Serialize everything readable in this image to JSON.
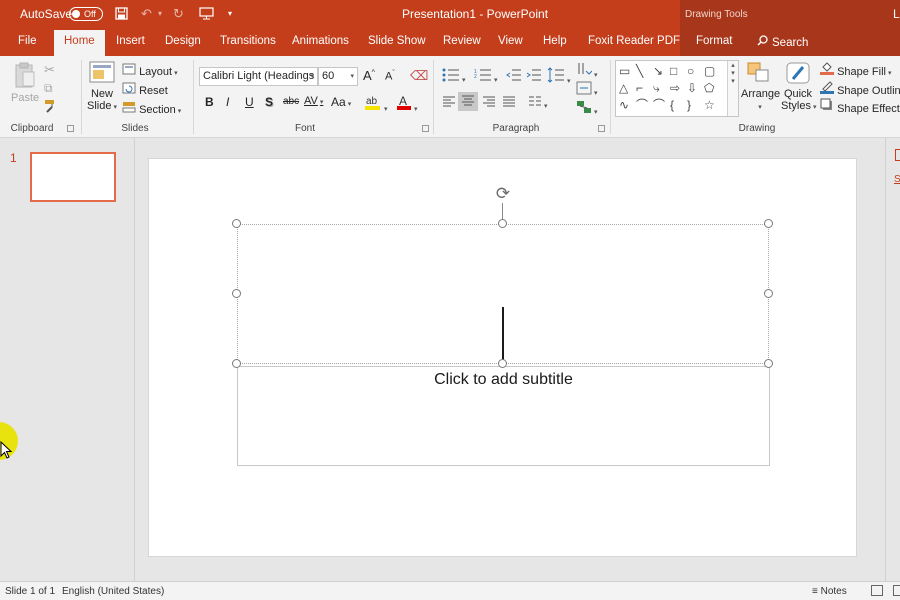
{
  "titlebar": {
    "autosave_label": "AutoSave",
    "autosave_state": "Off",
    "title": "Presentation1  -  PowerPoint",
    "context_label": "Drawing Tools",
    "user_initials": "La"
  },
  "tabs": [
    "File",
    "Home",
    "Insert",
    "Design",
    "Transitions",
    "Animations",
    "Slide Show",
    "Review",
    "View",
    "Help",
    "Foxit Reader PDF",
    "Format"
  ],
  "search_label": "Search",
  "ribbon": {
    "clipboard": {
      "paste": "Paste",
      "group": "Clipboard"
    },
    "slides": {
      "new": "New",
      "slide": "Slide",
      "layout": "Layout",
      "reset": "Reset",
      "section": "Section",
      "group": "Slides"
    },
    "font": {
      "name": "Calibri Light (Headings",
      "size": "60",
      "group": "Font",
      "bold": "B",
      "italic": "I",
      "underline": "U",
      "shadow": "S",
      "strike": "abc",
      "spacing": "AV",
      "case": "Aa"
    },
    "paragraph": {
      "group": "Paragraph"
    },
    "drawing": {
      "arrange": "Arrange",
      "quick": "Quick",
      "styles": "Styles",
      "fill": "Shape Fill",
      "outline": "Shape Outline",
      "effects": "Shape Effects",
      "group": "Drawing"
    }
  },
  "thumbs": {
    "number": "1"
  },
  "slide": {
    "subtitle_placeholder": "Click to add subtitle"
  },
  "statusbar": {
    "slide_info": "Slide 1 of 1",
    "language": "English (United States)",
    "notes": "Notes"
  },
  "colors": {
    "accent": "#c43e1c",
    "ribbon_bg": "#f3f3f3",
    "thumb_border": "#e36b4c",
    "highlight": "#e8e30e"
  },
  "icons": [
    "save-icon",
    "undo-icon",
    "redo-icon",
    "present-icon",
    "search-icon",
    "paste-icon",
    "cut-icon",
    "copy-icon",
    "format-painter-icon",
    "new-slide-icon",
    "layout-icon",
    "reset-icon",
    "section-icon",
    "rotate-handle-icon",
    "notes-icon",
    "normal-view-icon"
  ]
}
